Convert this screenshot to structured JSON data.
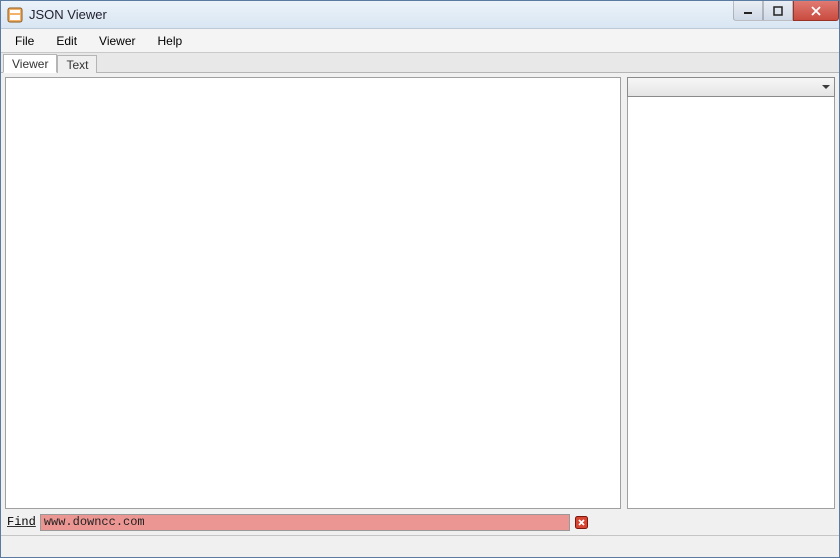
{
  "window": {
    "title": "JSON Viewer"
  },
  "menu": {
    "items": [
      "File",
      "Edit",
      "Viewer",
      "Help"
    ]
  },
  "tabs": {
    "items": [
      "Viewer",
      "Text"
    ],
    "active_index": 0
  },
  "side": {
    "dropdown_value": ""
  },
  "find": {
    "label": "Find",
    "value": "www.downcc.com",
    "error": true
  },
  "colors": {
    "find_error_bg": "#ec9693",
    "close_btn": "#c94b3f"
  }
}
